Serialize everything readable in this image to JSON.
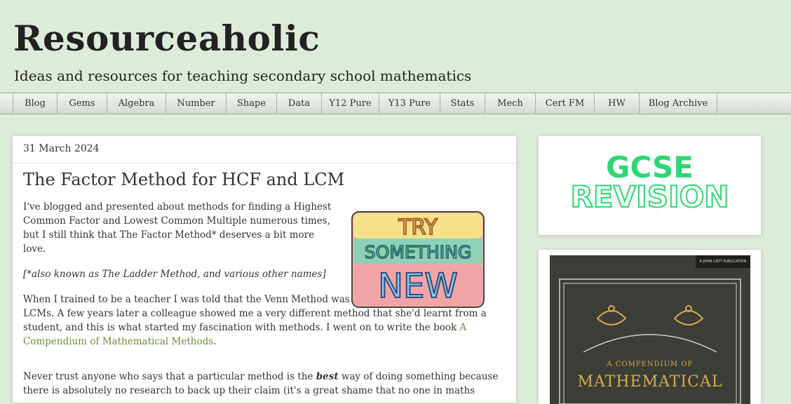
{
  "site": {
    "title": "Resourceaholic",
    "description": "Ideas and resources for teaching secondary school mathematics"
  },
  "nav": [
    {
      "label": "Blog",
      "w": 63
    },
    {
      "label": "Gems",
      "w": 71
    },
    {
      "label": "Algebra",
      "w": 84
    },
    {
      "label": "Number",
      "w": 86
    },
    {
      "label": "Shape",
      "w": 72
    },
    {
      "label": "Data",
      "w": 64
    },
    {
      "label": "Y12 Pure",
      "w": 82
    },
    {
      "label": "Y13 Pure",
      "w": 87
    },
    {
      "label": "Stats",
      "w": 64
    },
    {
      "label": "Mech",
      "w": 72
    },
    {
      "label": "Cert FM",
      "w": 84
    },
    {
      "label": "HW",
      "w": 64
    },
    {
      "label": "Blog Archive",
      "w": 112
    }
  ],
  "post": {
    "date": "31 March 2024",
    "title": "The Factor Method for HCF and LCM",
    "intro": "I've blogged and presented about methods for finding a Highest Common Factor and Lowest Common Multiple numerous times, but I still think that The Factor Method* deserves a bit more love.",
    "note": "[*also known as The Ladder Method, and various other names]",
    "para2_before": "When I trained to be a teacher I was told that the Venn Method was THE way to find HCFs and LCMs. A few years later a colleague showed me a very different method that she'd learnt from a student, and this is what started my fascination with methods. I went on to write the book ",
    "para2_link": "A Compendium of Mathematical Methods",
    "para2_after": ".",
    "para3_before": "Never trust anyone who says that a particular method is the ",
    "para3_em": "best",
    "para3_after": " way of doing something because there is absolutely no research to back up their claim (it's a great shame that no one in maths",
    "image_words": [
      "TRY",
      "SOMETHING",
      "NEW"
    ]
  },
  "sidebar": {
    "gcse_top": "GCSE",
    "gcse_bottom": "REVISION",
    "book_publisher": "A JOHN CATT PUBLICATION",
    "book_subtitle": "A COMPENDIUM OF",
    "book_title": "MATHEMATICAL",
    "colors": {
      "gcse_green": "#2ed572",
      "book_gold": "#d9a94a",
      "book_bg": "#3b3e37"
    }
  },
  "colors": {
    "page_bg": "#ddecd9",
    "link": "#6f8c3c"
  }
}
